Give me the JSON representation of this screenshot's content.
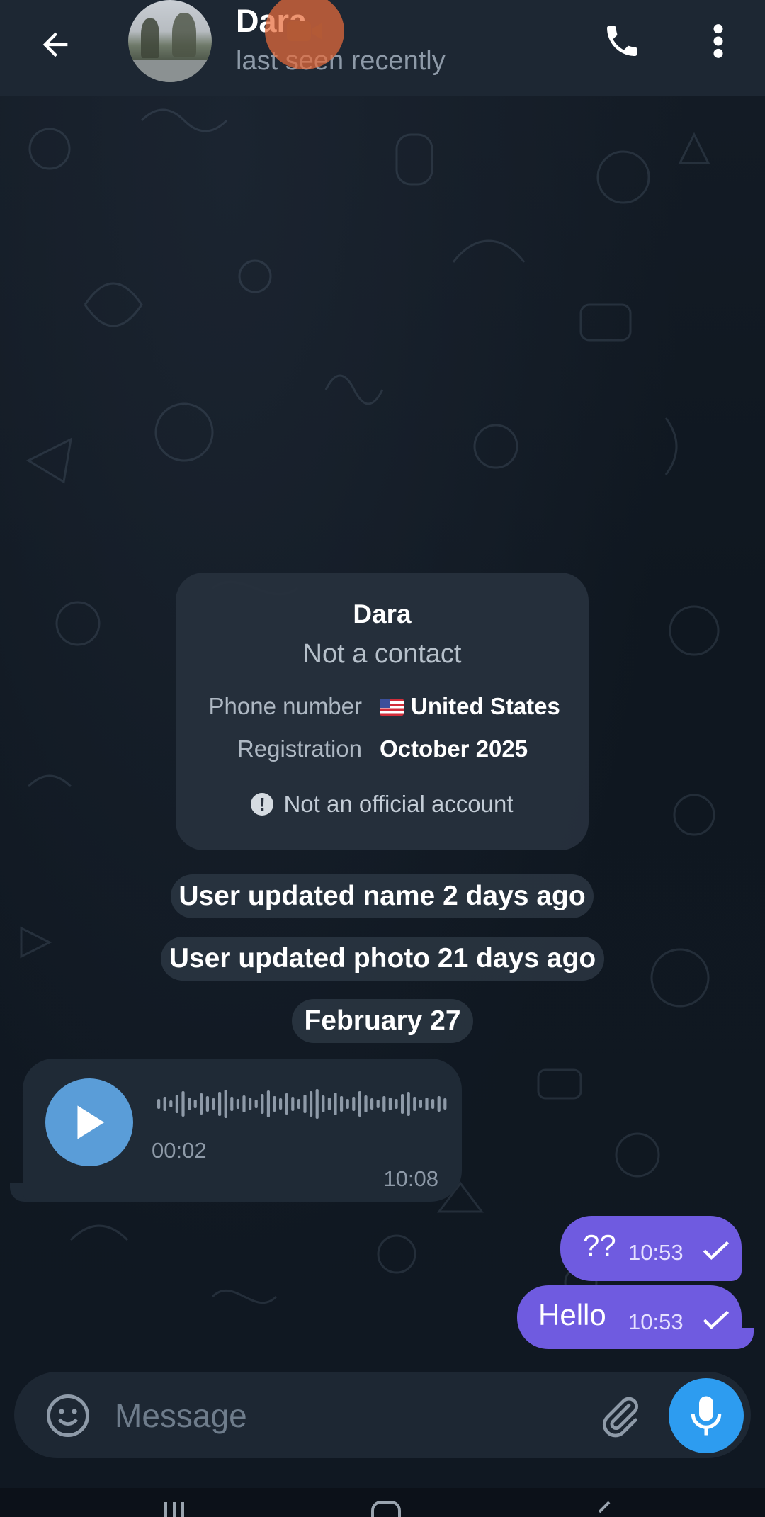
{
  "header": {
    "title": "Dara",
    "subtitle": "last seen recently"
  },
  "info_card": {
    "name": "Dara",
    "status": "Not a contact",
    "phone_label": "Phone number",
    "phone_value": "United States",
    "registration_label": "Registration",
    "registration_value": "October 2025",
    "official_note": "Not an official account"
  },
  "service_messages": {
    "name_update": "User updated name 2 days ago",
    "photo_update": "User updated photo 21 days ago",
    "date_divider": "February 27"
  },
  "voice_message": {
    "duration": "00:02",
    "time": "10:08"
  },
  "outgoing": [
    {
      "text": "??",
      "time": "10:53"
    },
    {
      "text": "Hello",
      "time": "10:53"
    }
  ],
  "composer": {
    "placeholder": "Message"
  },
  "colors": {
    "outgoing_bubble": "#6f5be0",
    "accent": "#2d9cf0",
    "play_button": "#5a9dd8",
    "video_overlay": "#e86c3c"
  },
  "icons": [
    "back-arrow-icon",
    "video-call-icon",
    "phone-icon",
    "more-vert-icon",
    "info-icon",
    "play-icon",
    "check-icon",
    "emoji-icon",
    "attach-icon",
    "mic-icon"
  ]
}
